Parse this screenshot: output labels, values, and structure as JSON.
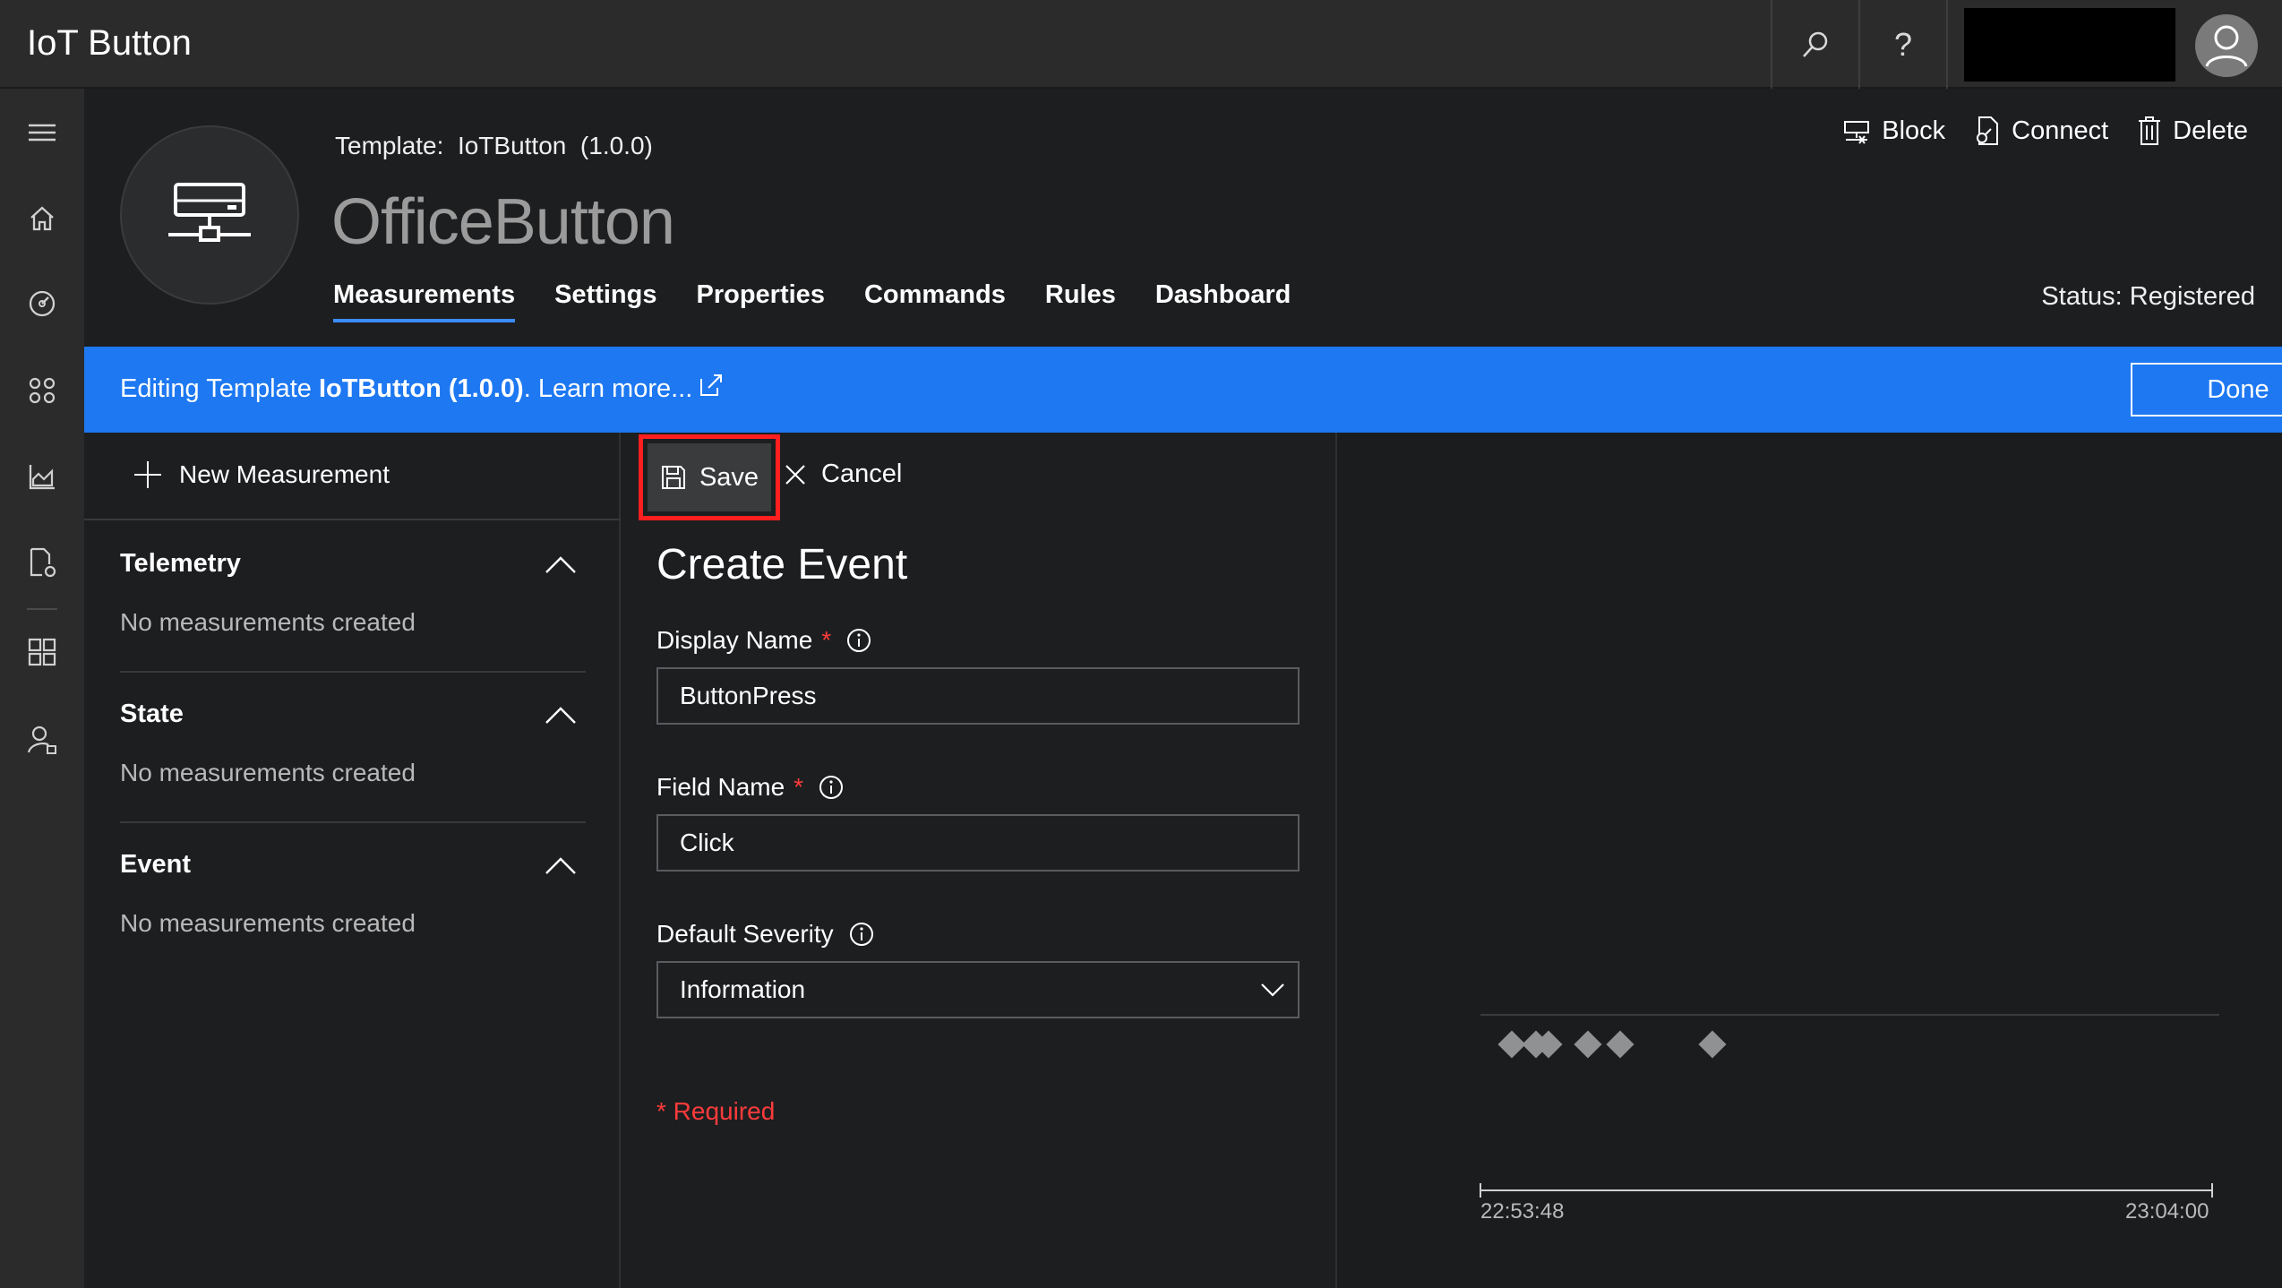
{
  "app": {
    "title": "IoT Button"
  },
  "header": {
    "template_label": "Template:  IoTButton  (1.0.0)",
    "device_name": "OfficeButton",
    "status": "Status: Registered",
    "actions": [
      {
        "label": "Block",
        "icon": "block-icon"
      },
      {
        "label": "Connect",
        "icon": "connect-icon"
      },
      {
        "label": "Delete",
        "icon": "trash-icon"
      }
    ],
    "tabs": [
      {
        "label": "Measurements",
        "active": true
      },
      {
        "label": "Settings"
      },
      {
        "label": "Properties"
      },
      {
        "label": "Commands"
      },
      {
        "label": "Rules"
      },
      {
        "label": "Dashboard"
      }
    ]
  },
  "banner": {
    "prefix": "Editing Template ",
    "template": "IoTButton (1.0.0)",
    "suffix": ". Learn more...",
    "done_label": "Done",
    "color": "#1d78f2"
  },
  "measurements": {
    "new_label": "New Measurement",
    "sections": [
      {
        "title": "Telemetry",
        "empty": "No measurements created"
      },
      {
        "title": "State",
        "empty": "No measurements created"
      },
      {
        "title": "Event",
        "empty": "No measurements created"
      }
    ]
  },
  "form": {
    "save_label": "Save",
    "cancel_label": "Cancel",
    "title": "Create Event",
    "display_name_label": "Display Name",
    "display_name_value": "ButtonPress",
    "field_name_label": "Field Name",
    "field_name_value": "Click",
    "severity_label": "Default Severity",
    "severity_value": "Information",
    "required_note": "* Required",
    "required_star": "*"
  },
  "preview": {
    "x_start_label": "22:53:48",
    "x_end_label": "23:04:00"
  },
  "colors": {
    "accent": "#3a8dff",
    "highlight": "#ff1f1f",
    "required": "#ff3b3b"
  }
}
